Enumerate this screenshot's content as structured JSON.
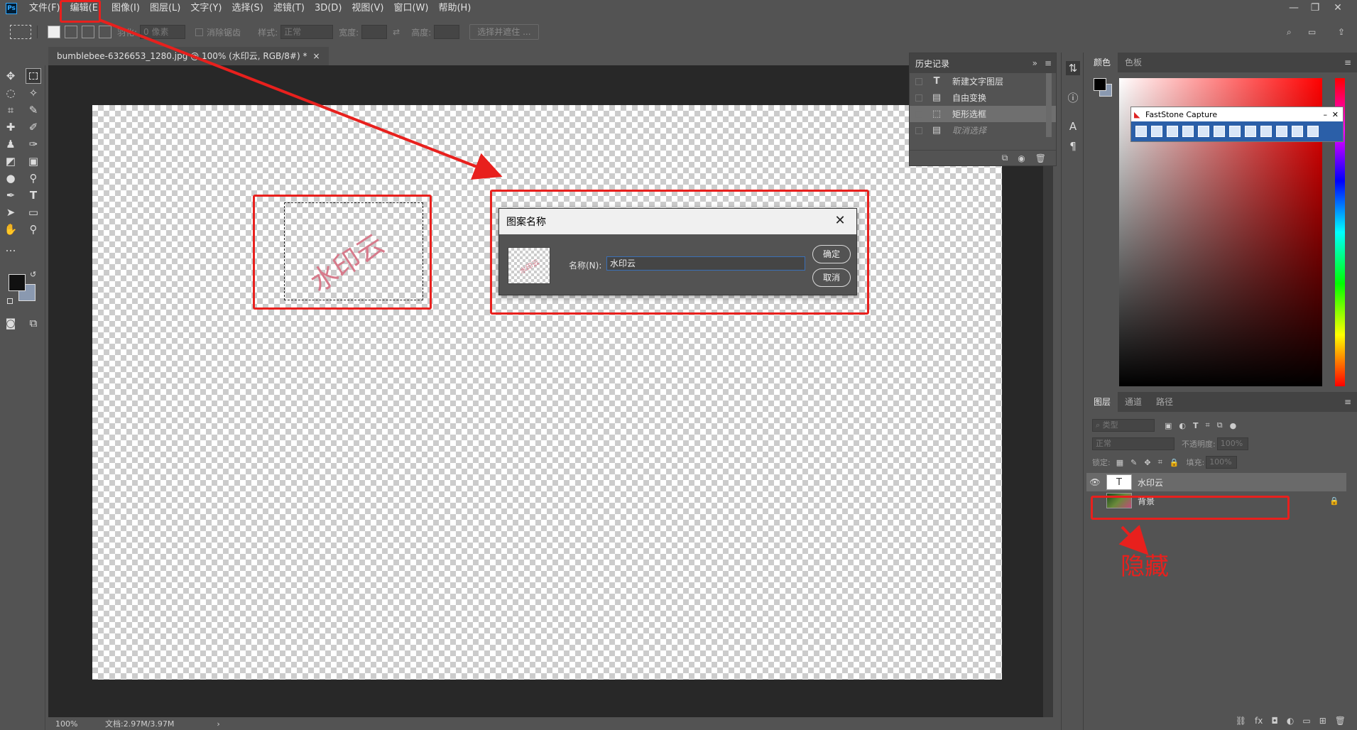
{
  "app": {
    "logo": "Ps"
  },
  "menu": [
    "文件(F)",
    "编辑(E)",
    "图像(I)",
    "图层(L)",
    "文字(Y)",
    "选择(S)",
    "滤镜(T)",
    "3D(D)",
    "视图(V)",
    "窗口(W)",
    "帮助(H)"
  ],
  "options": {
    "feather_label": "羽化:",
    "feather_value": "0 像素",
    "antialias_label": "消除锯齿",
    "style_label": "样式:",
    "style_value": "正常",
    "width_label": "宽度:",
    "height_label": "高度:",
    "select_mask_button": "选择并遮住 ..."
  },
  "document": {
    "tab_title": "bumblebee-6326653_1280.jpg @ 100% (水印云, RGB/8#) *",
    "tab_close": "×",
    "watermark_text": "水印云"
  },
  "status": {
    "zoom": "100%",
    "doc_info": "文档:2.97M/3.97M",
    "arrow": "›"
  },
  "history": {
    "title": "历史记录",
    "items": [
      {
        "label": "新建文字图层",
        "icon": "text-icon"
      },
      {
        "label": "自由变换",
        "icon": "doc-icon"
      },
      {
        "label": "矩形选框",
        "icon": "marquee-icon"
      },
      {
        "label": "取消选择",
        "icon": "doc-icon"
      }
    ]
  },
  "color_panel": {
    "tabs": [
      "颜色",
      "色板"
    ]
  },
  "faststone": {
    "title": "FastStone Capture"
  },
  "layers_panel": {
    "tabs": [
      "图层",
      "通道",
      "路径"
    ],
    "filter_placeholder": "类型",
    "blend_mode": "正常",
    "opacity_label": "不透明度:",
    "opacity_value": "100%",
    "lock_label": "锁定:",
    "fill_label": "填充:",
    "fill_value": "100%",
    "layers": [
      {
        "name": "水印云",
        "type": "text",
        "visible": true
      },
      {
        "name": "背景",
        "type": "image",
        "visible": false,
        "locked": true
      }
    ]
  },
  "dialog": {
    "title": "图案名称",
    "name_label": "名称(N):",
    "name_value": "水印云",
    "ok_button": "确定",
    "cancel_button": "取消",
    "thumb_text": "水印云"
  },
  "annotation": {
    "text": "隐藏",
    "color": "#e8201d"
  }
}
